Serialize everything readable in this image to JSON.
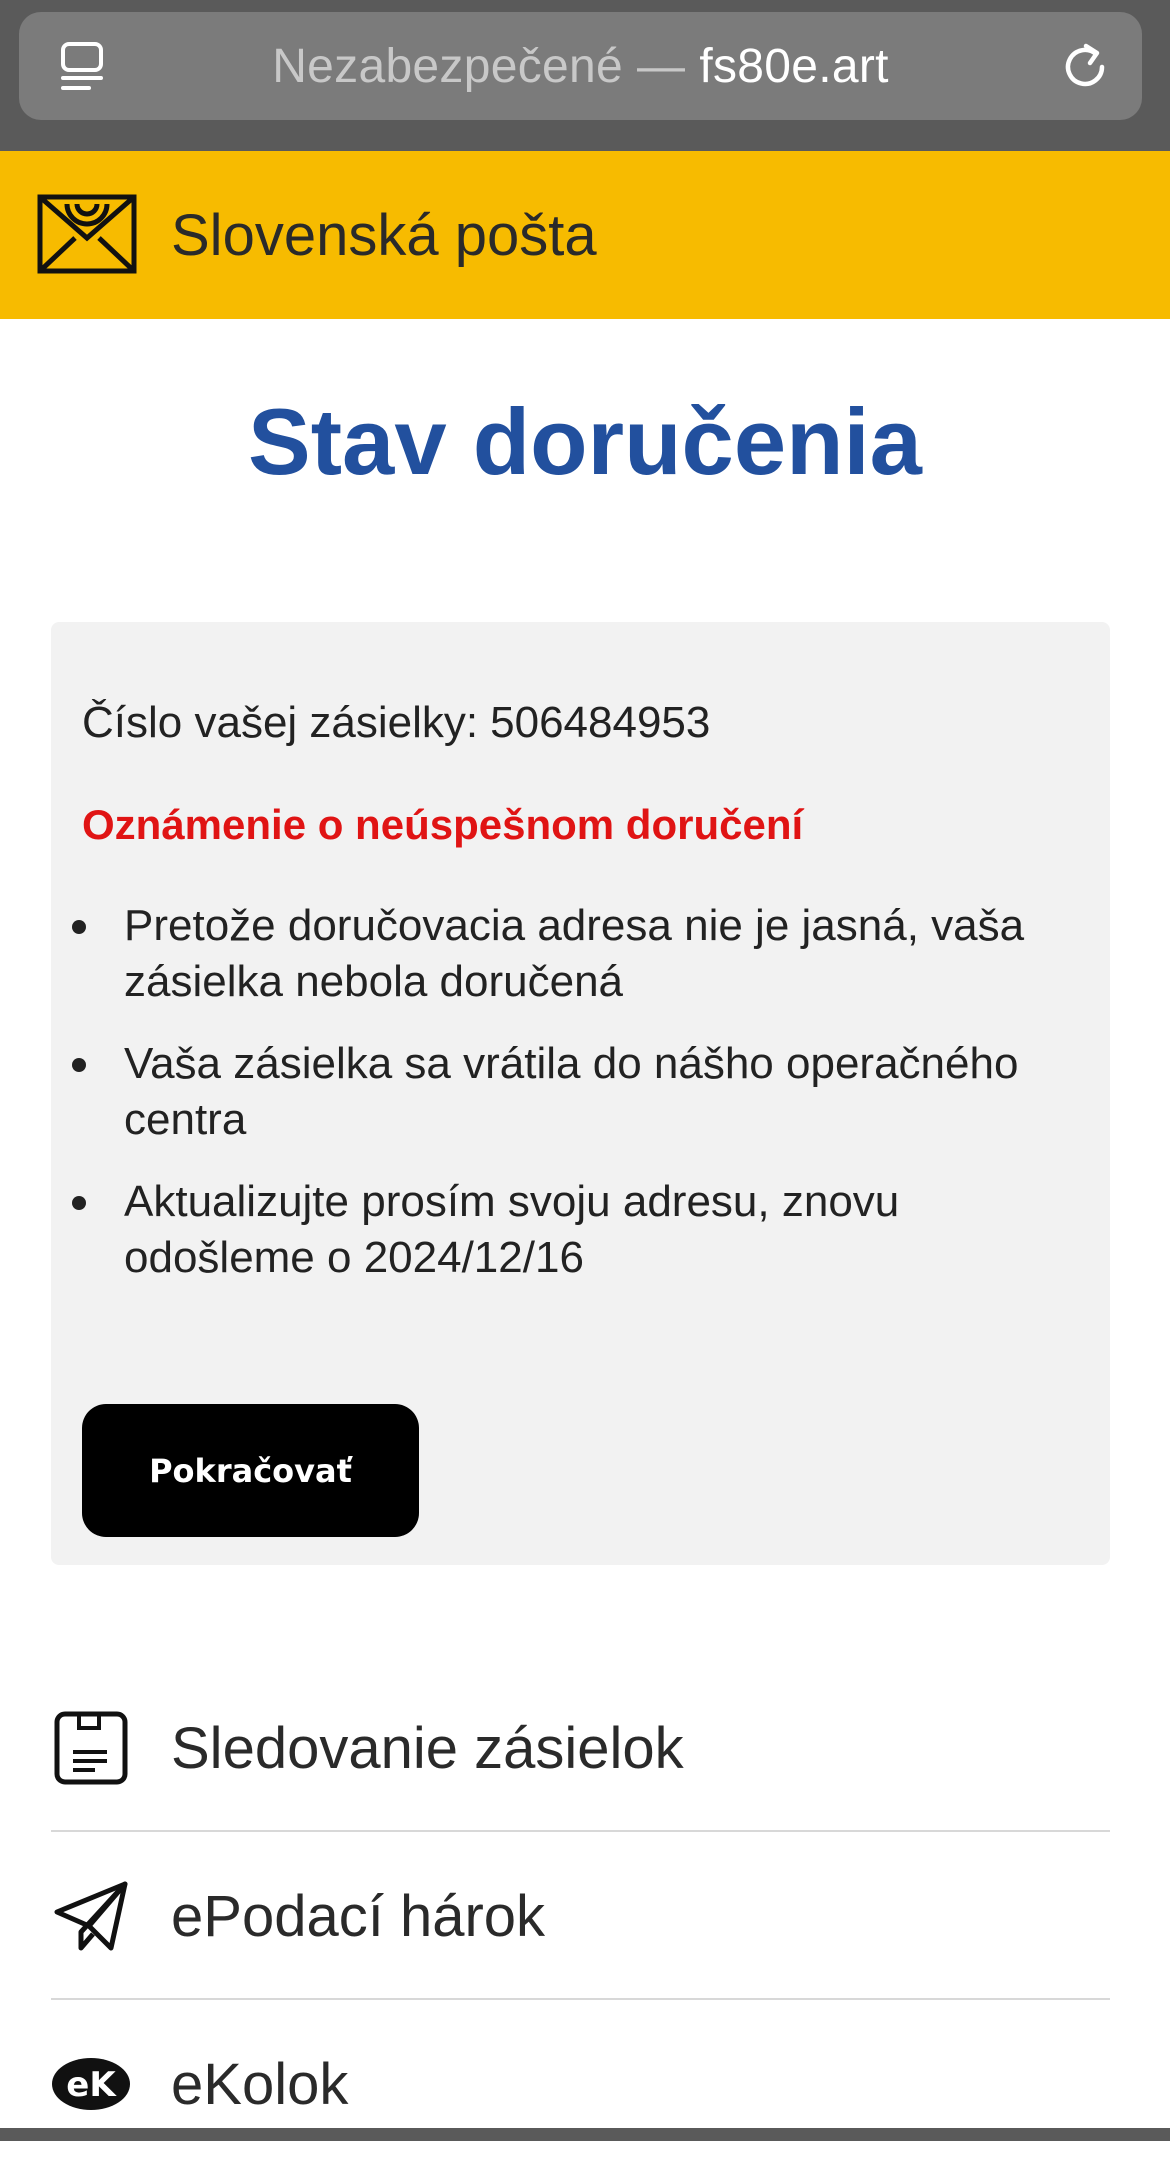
{
  "browser": {
    "security_label": "Nezabezpečené",
    "separator": "—",
    "host": "fs80e.art"
  },
  "header": {
    "site_name": "Slovenská pošta"
  },
  "page": {
    "title": "Stav doručenia"
  },
  "card": {
    "tracking_label": "Číslo vašej zásielky:",
    "tracking_number": "506484953",
    "notice": "Oznámenie o neúspešnom doručení",
    "bullets": [
      "Pretože doručovacia adresa nie je jasná, vaša zásielka nebola doručená",
      "Vaša zásielka sa vrátila do nášho operačného centra",
      "Aktualizujte prosím svoju adresu, znovu odošleme o 2024/12/16"
    ],
    "button_label": "Pokračovať"
  },
  "menu": {
    "items": [
      {
        "label": "Sledovanie zásielok",
        "icon": "tracking-document-icon"
      },
      {
        "label": "ePodací hárok",
        "icon": "paper-plane-icon"
      },
      {
        "label": "eKolok",
        "icon": "ekolok-logo-icon"
      }
    ]
  },
  "colors": {
    "header_yellow": "#f7bb00",
    "title_blue": "#22509e",
    "notice_red": "#e01414",
    "button_black": "#000000"
  }
}
